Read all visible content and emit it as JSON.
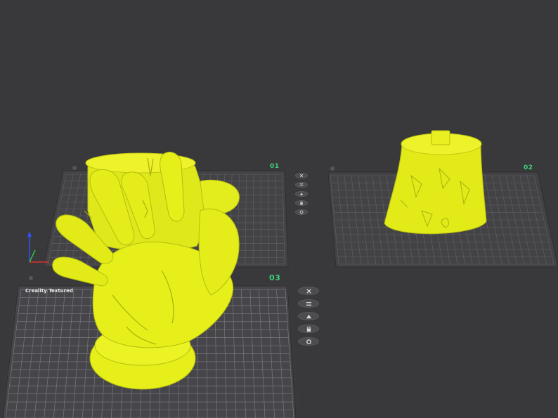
{
  "plates": [
    {
      "number": "01"
    },
    {
      "number": "02"
    },
    {
      "number": "03",
      "label": "Creality Textured"
    }
  ],
  "plate_tools": [
    {
      "icon": "close-icon"
    },
    {
      "icon": "arrange-icon"
    },
    {
      "icon": "orient-icon"
    },
    {
      "icon": "lock-icon"
    },
    {
      "icon": "settings-icon"
    }
  ],
  "colors": {
    "background": "#39393b",
    "plate": "#454548",
    "grid_line": "#6a6a6e",
    "model": "#e6ef1a",
    "plate_number": "#3ed27a",
    "axis_x": "#e03030",
    "axis_y": "#30c040",
    "axis_z": "#3050ff"
  }
}
